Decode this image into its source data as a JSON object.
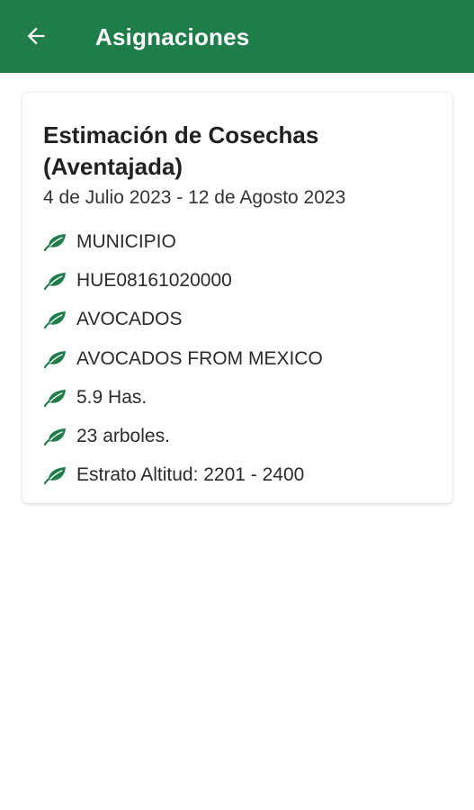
{
  "header": {
    "title": "Asignaciones",
    "background_color": "#1f7d4a",
    "back_icon": "arrow-left-icon"
  },
  "assignment": {
    "title": "Estimación de Cosechas (Aventajada)",
    "dates": "4 de Julio 2023 - 12 de Agosto 2023",
    "item_icon": "leaf-icon",
    "icon_color": "#1f7d4a",
    "details": [
      "MUNICIPIO",
      "HUE08161020000",
      "AVOCADOS",
      "AVOCADOS FROM MEXICO",
      "5.9 Has.",
      "23 arboles.",
      "Estrato Altitud: 2201 - 2400"
    ]
  }
}
